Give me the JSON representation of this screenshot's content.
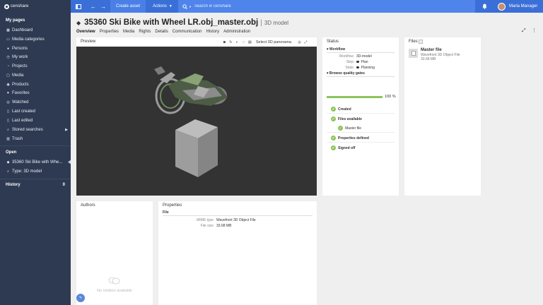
{
  "topbar": {
    "logo_text": "censhare",
    "create_asset": "Create asset",
    "actions": "Actions",
    "search_placeholder": "Search in censhare",
    "user_name": "Maria Manager"
  },
  "sidebar": {
    "my_pages_title": "My pages",
    "items": [
      {
        "label": "Dashboard",
        "icon": "dashboard-icon"
      },
      {
        "label": "Media categories",
        "icon": "folder-icon"
      },
      {
        "label": "Persons",
        "icon": "person-icon"
      },
      {
        "label": "My work",
        "icon": "clock-icon"
      },
      {
        "label": "Projects",
        "icon": "project-icon"
      },
      {
        "label": "Media",
        "icon": "media-icon"
      },
      {
        "label": "Products",
        "icon": "product-icon"
      },
      {
        "label": "Favorites",
        "icon": "heart-icon"
      },
      {
        "label": "Watched",
        "icon": "eye-icon"
      },
      {
        "label": "Last created",
        "icon": "document-icon"
      },
      {
        "label": "Last edited",
        "icon": "document-icon"
      },
      {
        "label": "Stored searches",
        "icon": "search-icon"
      },
      {
        "label": "Trash",
        "icon": "trash-icon"
      }
    ],
    "open_title": "Open",
    "open_items": [
      {
        "label": "35360 Ski Bike with Whe...",
        "icon": "cube-icon"
      },
      {
        "label": "Type: 3D model",
        "icon": "search-icon"
      }
    ],
    "history_title": "History",
    "history_count": "0"
  },
  "asset": {
    "title": "35360 Ski Bike with Wheel LR.obj_master.obj",
    "separator": "|",
    "type": "3D model",
    "tabs": [
      "Overview",
      "Properties",
      "Media",
      "Rights",
      "Details",
      "Communication",
      "History",
      "Administration"
    ]
  },
  "preview": {
    "title": "Preview",
    "select_label": "Select 3D panorama"
  },
  "status": {
    "title": "Status",
    "workflow_section": "Workflow",
    "workflow_key": "Workflow",
    "workflow_value": "3D-model",
    "step_key": "Step",
    "step_value": "Plan",
    "state_key": "State",
    "state_value": "Planning",
    "quality_section": "Browse quality gates",
    "progress_percent": 100,
    "progress_label": "100 %",
    "gates": [
      {
        "label": "Created",
        "bold": true
      },
      {
        "label": "Files available",
        "bold": true
      },
      {
        "label": "Master file",
        "bold": false
      },
      {
        "label": "Properties defined",
        "bold": true
      },
      {
        "label": "Signed off",
        "bold": true
      }
    ]
  },
  "files": {
    "title": "Files",
    "master_label": "Master file",
    "file_type": "Wavefront 3D Object File",
    "file_size": "33.68 MB"
  },
  "authors": {
    "title": "Authors",
    "empty_text": "No relation available"
  },
  "properties": {
    "title": "Properties",
    "subtitle": "File",
    "rows": [
      {
        "key": "MIME type",
        "value": "Wavefront 3D Object File"
      },
      {
        "key": "File size",
        "value": "33.68 MB"
      }
    ]
  }
}
